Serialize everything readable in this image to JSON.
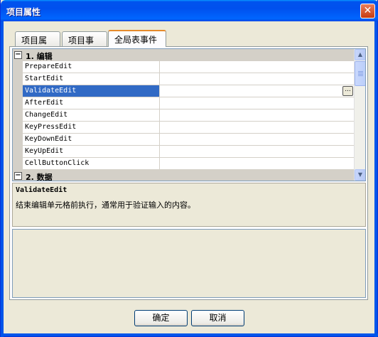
{
  "window": {
    "title": "项目属性",
    "close_label": "✕"
  },
  "tabs": [
    {
      "label": "项目属性"
    },
    {
      "label": "项目事件"
    },
    {
      "label": "全局表事件"
    }
  ],
  "grid": {
    "categories": [
      {
        "toggle": "⊟",
        "label": "1. 编辑"
      },
      {
        "toggle": "⊟",
        "label": "2. 数据"
      }
    ],
    "properties": [
      {
        "name": "PrepareEdit",
        "value": ""
      },
      {
        "name": "StartEdit",
        "value": ""
      },
      {
        "name": "ValidateEdit",
        "value": "",
        "selected": true
      },
      {
        "name": "AfterEdit",
        "value": ""
      },
      {
        "name": "ChangeEdit",
        "value": ""
      },
      {
        "name": "KeyPressEdit",
        "value": ""
      },
      {
        "name": "KeyDownEdit",
        "value": ""
      },
      {
        "name": "KeyUpEdit",
        "value": ""
      },
      {
        "name": "CellButtonClick",
        "value": ""
      }
    ],
    "ellipsis_label": "..."
  },
  "description": {
    "title": "ValidateEdit",
    "text": "结束编辑单元格前执行，通常用于验证输入的内容。"
  },
  "buttons": {
    "ok": "确定",
    "cancel": "取消"
  },
  "icons": {
    "close": "close-icon",
    "collapse": "minus-box-icon",
    "ellipsis": "ellipsis-icon",
    "scroll_up": "chevron-up-icon",
    "scroll_down": "chevron-down-icon"
  },
  "colors": {
    "titlebar": "#0055ea",
    "selection": "#316ac5",
    "tab_active_accent": "#e68b2c"
  }
}
